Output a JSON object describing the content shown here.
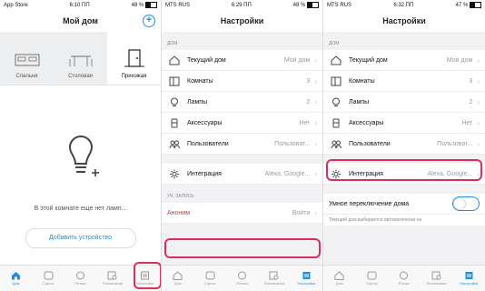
{
  "colors": {
    "accent": "#1e8fe0",
    "highlight": "#d92f5b",
    "danger": "#e0312f"
  },
  "screen1": {
    "status": {
      "left": "App Store",
      "time": "6:10 ПП",
      "battery": "48 %",
      "battery_level": 0.48
    },
    "title": "Мой дом",
    "rooms": [
      {
        "label": "Спальня",
        "icon": "bed-icon"
      },
      {
        "label": "Столовая",
        "icon": "dining-table-icon"
      },
      {
        "label": "Прихожая",
        "icon": "door-icon"
      }
    ],
    "empty_text": "В этой комнате еще нет ламп...",
    "add_button": "Добавить устройство",
    "tabs": [
      {
        "label": "Дом",
        "icon": "house-icon"
      },
      {
        "label": "Сцены",
        "icon": "scenes-icon"
      },
      {
        "label": "Ритмы",
        "icon": "rhythms-icon"
      },
      {
        "label": "Расписания",
        "icon": "schedule-icon"
      },
      {
        "label": "Настройки",
        "icon": "settings-icon"
      }
    ]
  },
  "screen2": {
    "status": {
      "left": "MTS RUS",
      "time": "6:29 ПП",
      "battery": "48 %",
      "battery_level": 0.48
    },
    "title": "Настройки",
    "section_home": "ДОМ",
    "rows": [
      {
        "label": "Текущий дом",
        "value": "Мой дом",
        "icon": "home-outline-icon"
      },
      {
        "label": "Комнаты",
        "value": "3",
        "icon": "rooms-icon"
      },
      {
        "label": "Лампы",
        "value": "2",
        "icon": "lamps-icon"
      },
      {
        "label": "Аксессуары",
        "value": "Нет",
        "icon": "accessory-icon"
      },
      {
        "label": "Пользователи",
        "value": "Пользоват...",
        "icon": "users-icon"
      }
    ],
    "integration": {
      "label": "Интеграция",
      "value": "Alexa, Google...",
      "icon": "integration-icon"
    },
    "section_account": "УЧ. ЗАПИСЬ",
    "account": {
      "label": "Аноним",
      "value": "Войти"
    },
    "tabs": [
      {
        "label": "Дом"
      },
      {
        "label": "Сцены"
      },
      {
        "label": "Ритмы"
      },
      {
        "label": "Расписания"
      },
      {
        "label": "Настройки"
      }
    ]
  },
  "screen3": {
    "status": {
      "left": "MTS RUS",
      "time": "6:32 ПП",
      "battery": "47 %",
      "battery_level": 0.47
    },
    "title": "Настройки",
    "section_home": "ДОМ",
    "rows": [
      {
        "label": "Текущий дом",
        "value": "Мой дом"
      },
      {
        "label": "Комнаты",
        "value": "3"
      },
      {
        "label": "Лампы",
        "value": "2"
      },
      {
        "label": "Аксессуары",
        "value": "Нет"
      },
      {
        "label": "Пользователи",
        "value": "Пользоват..."
      }
    ],
    "integration": {
      "label": "Интеграция",
      "value": "Alexa, Google..."
    },
    "smart_switch": {
      "label": "Умное переключение дома",
      "checked": false
    },
    "note": "Текущий дом выбирается автоматически на",
    "tabs": [
      {
        "label": "Дом"
      },
      {
        "label": "Сцены"
      },
      {
        "label": "Ритмы"
      },
      {
        "label": "Расписания"
      },
      {
        "label": "Настройки"
      }
    ]
  }
}
